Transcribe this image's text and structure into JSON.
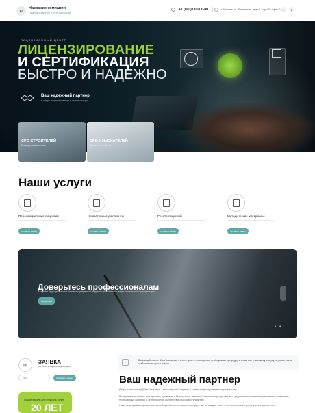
{
  "header": {
    "logo_glyph": "↩",
    "company_name": "Название компании",
    "company_sub": "Лицензирование и сертификация",
    "phone": "+7 (000) 000-00-00",
    "address": "г. Москва ул. Ленинская, дом 0, корп 0, офис 0",
    "social": [
      "vk",
      "tg"
    ]
  },
  "hero": {
    "kicker": "ЛИЦЕНЗИОННЫЙ ЦЕНТР",
    "line1": "ЛИЦЕНЗИРОВАНИЕ",
    "line2": "И СЕРТИФИКАЦИЯ",
    "line3": "БЫСТРО И НАДЕЖНО",
    "partner_title": "Ваш надежный партнер",
    "partner_sub": "в сфере лицензирования и сертификации",
    "cards": [
      {
        "title": "СРО СТРОИТЕЛЕЙ",
        "sub": "Проверено качеством"
      },
      {
        "title": "СРО ИЗЫСКАТЕЛЕЙ",
        "sub": "Проверено опытом"
      }
    ]
  },
  "services": {
    "title": "Наши услуги",
    "button_label": "Оставить заявку",
    "items": [
      {
        "label": "Переоформление лицензий",
        "icon": "document-icon"
      },
      {
        "label": "Нормативные документы",
        "icon": "book-icon"
      },
      {
        "label": "Реестр лицензий",
        "icon": "certificate-icon"
      },
      {
        "label": "Методические материалы",
        "icon": "checklist-icon"
      }
    ]
  },
  "banner": {
    "title": "Доверьтесь профессионалам",
    "sub": "Создайте будущее вашего бизнеса с уверенной поддержкой в области лицензирования и сертификации",
    "button": "Подробнее"
  },
  "request": {
    "title": "ЗАЯВКА",
    "sub": "на бесплатную консультацию",
    "placeholder": "Имя",
    "button": "Оформить заявку"
  },
  "years": {
    "small": "Осуществляем деятельность более",
    "big": "20 ЛЕТ"
  },
  "about": {
    "quote": "Взаимодействие с [Имя Компании] – это не просто прохождение необходимых процедур, это ваш шаг к высокому статусу на рынке, залог стабильности пути к успеху.",
    "title": "Ваш надежный партнер",
    "p1": "Добро пожаловать в [Имя Компании] – ваш надежный партнер в сфере лицензирования и сертификации.",
    "p2": "В современном бизнес-пространстве, где время и безопасность являются ключевыми ресурсами, мы предлагаем комплексные решения по получению необходимых лицензий и сертификатов, соответствия высоким стандартам.",
    "p3": "Наша команда квалифицированных специалистов готова сопровождать вас на каждом этапе — от консультации до получения документов."
  },
  "colors": {
    "accent": "#a2d13c",
    "teal": "#5fa8a5",
    "dark": "#0d1f27"
  }
}
